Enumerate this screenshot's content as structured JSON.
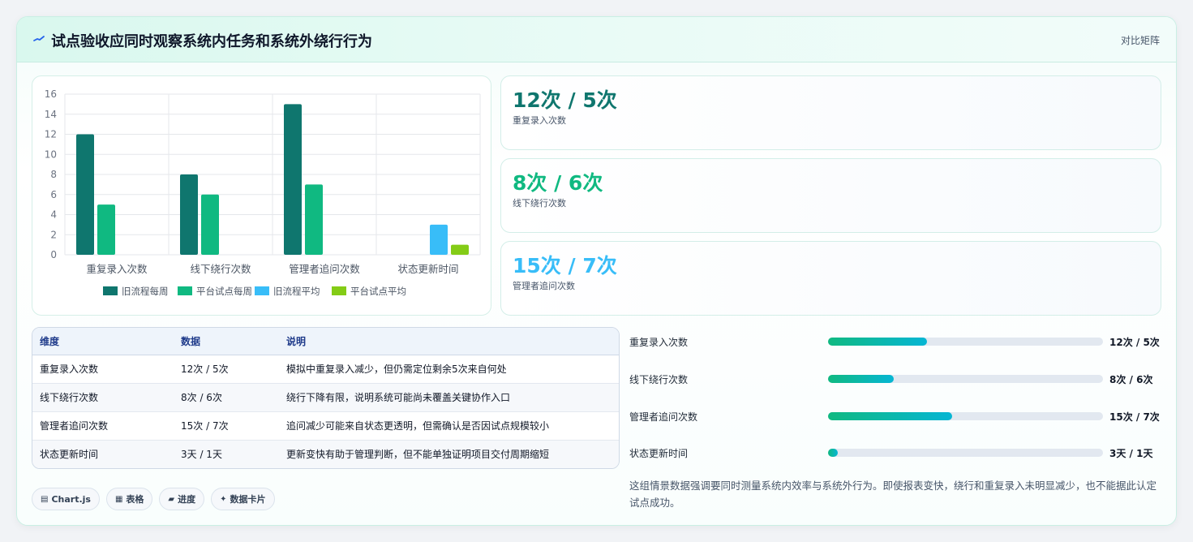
{
  "header": {
    "title": "试点验收应同时观察系统内任务和系统外绕行行为",
    "link": "对比矩阵"
  },
  "colors": {
    "teal_dark": "#0f766e",
    "green": "#10b981",
    "sky": "#38bdf8",
    "lime": "#84cc16"
  },
  "stats": [
    {
      "value": "12次 / 5次",
      "label": "重复录入次数",
      "color": "#0f766e"
    },
    {
      "value": "8次 / 6次",
      "label": "线下绕行次数",
      "color": "#10b981"
    },
    {
      "value": "15次 / 7次",
      "label": "管理者追问次数",
      "color": "#38bdf8"
    }
  ],
  "table": {
    "headers": [
      "维度",
      "数据",
      "说明"
    ],
    "rows": [
      [
        "重复录入次数",
        "12次 / 5次",
        "模拟中重复录入减少，但仍需定位剩余5次来自何处"
      ],
      [
        "线下绕行次数",
        "8次 / 6次",
        "绕行下降有限，说明系统可能尚未覆盖关键协作入口"
      ],
      [
        "管理者追问次数",
        "15次 / 7次",
        "追问减少可能来自状态更透明，但需确认是否因试点规模较小"
      ],
      [
        "状态更新时间",
        "3天 / 1天",
        "更新变快有助于管理判断，但不能单独证明项目交付周期缩短"
      ]
    ]
  },
  "progress": [
    {
      "label": "重复录入次数",
      "value": "12次 / 5次",
      "fraction": 0.36
    },
    {
      "label": "线下绕行次数",
      "value": "8次 / 6次",
      "fraction": 0.24
    },
    {
      "label": "管理者追问次数",
      "value": "15次 / 7次",
      "fraction": 0.45
    },
    {
      "label": "状态更新时间",
      "value": "3天 / 1天",
      "fraction": 0.03
    }
  ],
  "note": "这组情景数据强调要同时测量系统内效率与系统外行为。即使报表变快，绕行和重复录入未明显减少，也不能据此认定试点成功。",
  "tags": [
    {
      "icon": "▤",
      "label": "Chart.js"
    },
    {
      "icon": "▦",
      "label": "表格"
    },
    {
      "icon": "▰",
      "label": "进度"
    },
    {
      "icon": "✦",
      "label": "数据卡片"
    }
  ],
  "chart_data": {
    "type": "bar",
    "categories": [
      "重复录入次数",
      "线下绕行次数",
      "管理者追问次数",
      "状态更新时间"
    ],
    "series": [
      {
        "name": "旧流程每周",
        "color": "#0f766e",
        "values": [
          12,
          8,
          15,
          null
        ]
      },
      {
        "name": "平台试点每周",
        "color": "#10b981",
        "values": [
          5,
          6,
          7,
          null
        ]
      },
      {
        "name": "旧流程平均",
        "color": "#38bdf8",
        "values": [
          null,
          null,
          null,
          3
        ]
      },
      {
        "name": "平台试点平均",
        "color": "#84cc16",
        "values": [
          null,
          null,
          null,
          1
        ]
      }
    ],
    "ylim": [
      0,
      16
    ],
    "yticks": [
      0,
      2,
      4,
      6,
      8,
      10,
      12,
      14,
      16
    ],
    "grid": true,
    "legend": "bottom"
  }
}
